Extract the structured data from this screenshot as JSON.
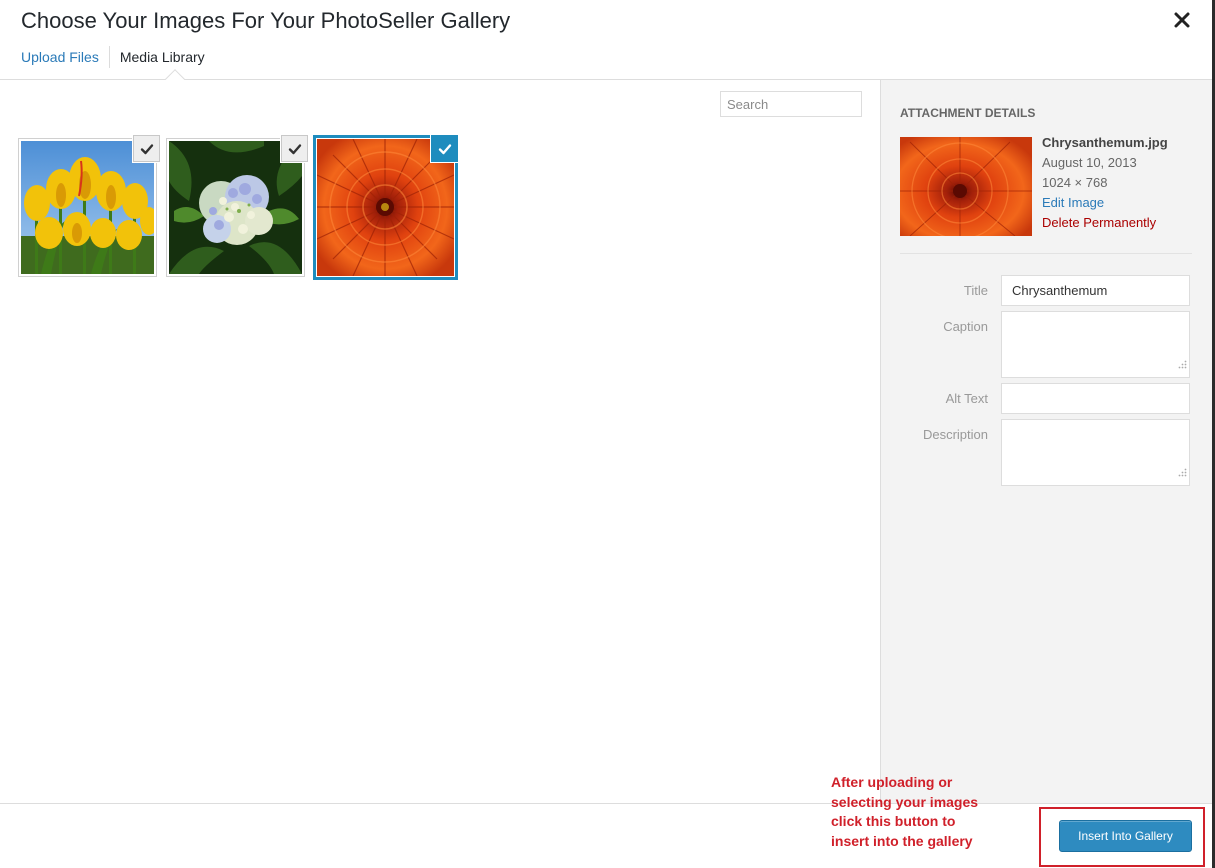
{
  "modal": {
    "title": "Choose Your Images For Your PhotoSeller Gallery",
    "close_icon": "close-icon"
  },
  "router": {
    "tabs": [
      {
        "label": "Upload Files",
        "state": "link"
      },
      {
        "label": "Media Library",
        "state": "active"
      }
    ]
  },
  "search": {
    "placeholder": "Search",
    "value": ""
  },
  "attachments": [
    {
      "name": "tulips",
      "picture": "yellow tulips",
      "checked": true,
      "selected": false
    },
    {
      "name": "hydrangeas",
      "picture": "hydrangea flowers",
      "checked": true,
      "selected": false
    },
    {
      "name": "chrysanthemum",
      "picture": "orange chrysanthemum",
      "checked": true,
      "selected": true
    }
  ],
  "details": {
    "heading": "Attachment Details",
    "filename": "Chrysanthemum.jpg",
    "date": "August 10, 2013",
    "dimensions": "1024 × 768",
    "edit_label": "Edit Image",
    "delete_label": "Delete Permanently",
    "fields": {
      "title_label": "Title",
      "title_value": "Chrysanthemum",
      "caption_label": "Caption",
      "caption_value": "",
      "alt_label": "Alt Text",
      "alt_value": "",
      "description_label": "Description",
      "description_value": ""
    }
  },
  "toolbar": {
    "insert_label": "Insert Into Gallery"
  },
  "annotation": {
    "text": "After uploading or\nselecting your images\nclick this button to\ninsert into the gallery"
  },
  "colors": {
    "accent": "#1e8cbe",
    "link": "#2a7ab8",
    "delete": "#aa0000",
    "annotation": "#d0202a",
    "button": "#2e8bc0"
  }
}
